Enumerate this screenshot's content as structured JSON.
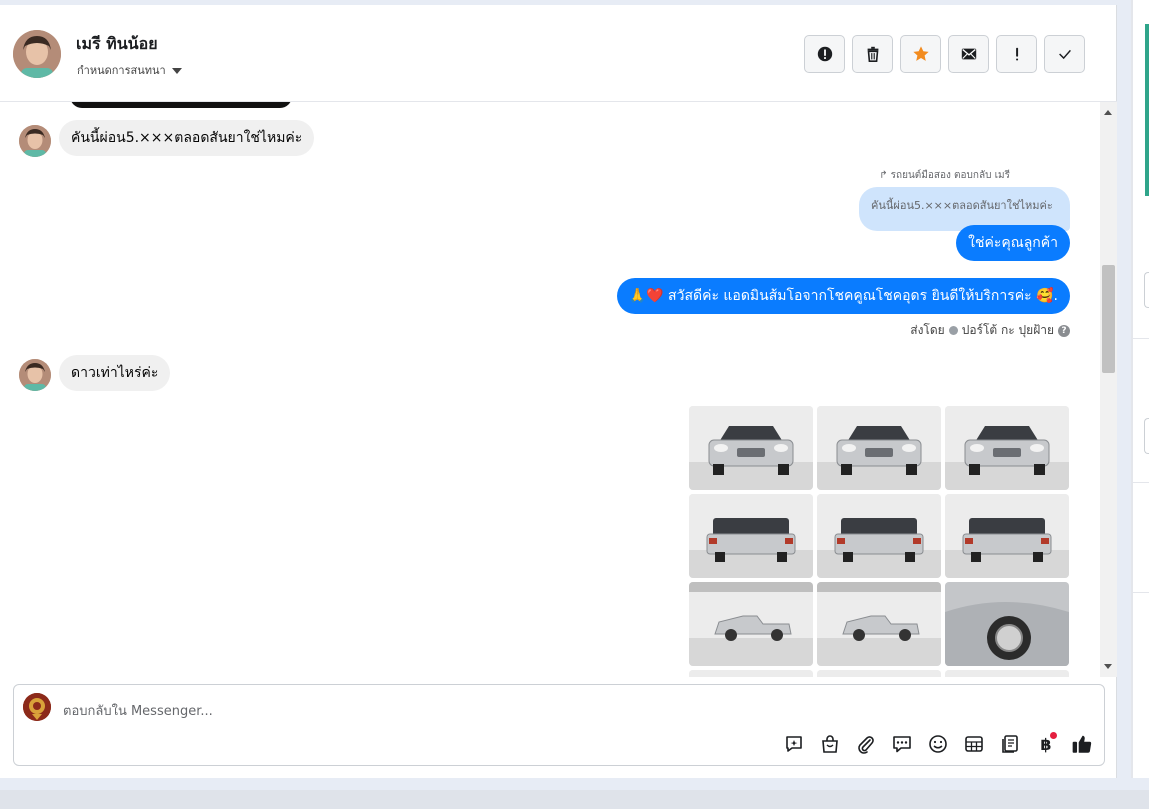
{
  "header": {
    "contact_name": "เมรี ทินน้อย",
    "conversation_setting": "กำหนดการสนทนา",
    "actions": [
      "spam-report",
      "delete",
      "star",
      "mark-unread",
      "priority",
      "done"
    ]
  },
  "thread": {
    "msg1": "คันนี้ผ่อน5.×××ตลอดสันยาใช่ไหมค่ะ",
    "reply_note": "รถยนต์มือสอง ตอบกลับ เมรี",
    "quoted": "คันนี้ผ่อน5.×××ตลอดสันยาใช่ไหมค่ะ",
    "reply": "ใช่ค่ะคุณลูกค้า",
    "greeting": "สวัสดีค่ะ แอดมินส้มโอจากโชคคูณโชคอุดร ยินดีให้บริการค่ะ",
    "greeting_emoji_left": "🙏❤️",
    "greeting_emoji_right": "🥰.",
    "sent_by_prefix": "ส่งโดย",
    "sent_by_name": "ปอร์โต้ กะ ปุยฝ้าย",
    "msg2": "ดาวเท่าไหร่ค่ะ",
    "photo_count": 12
  },
  "composer": {
    "placeholder": "ตอบกลับใน Messenger...",
    "tools": [
      "quick-reply",
      "shop",
      "attach",
      "saved-reply",
      "emoji",
      "table",
      "catalog",
      "baht",
      "like"
    ],
    "baht_symbol": "฿"
  },
  "colors": {
    "outgoing": "#0a7cff",
    "incoming": "#f0f0f0",
    "star": "#f28b1f",
    "accent_green": "#2fa58a"
  }
}
